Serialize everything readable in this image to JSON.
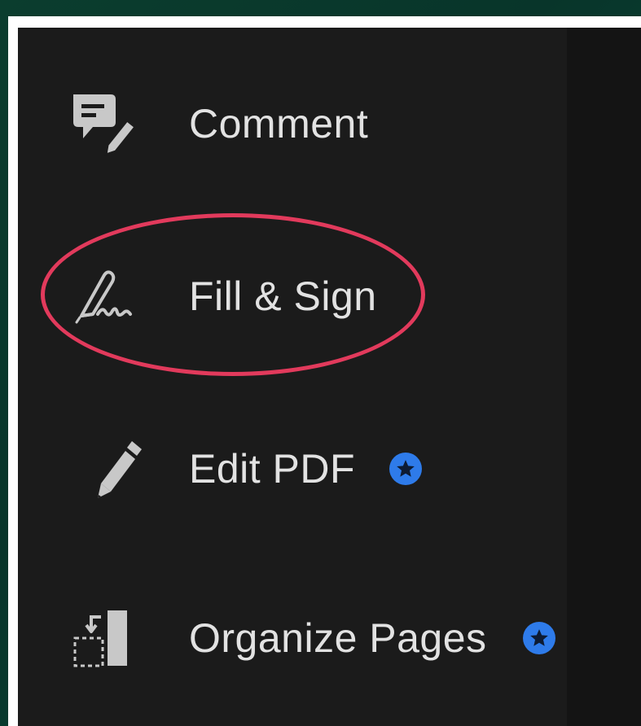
{
  "tools": {
    "comment": {
      "label": "Comment",
      "icon": "comment-icon"
    },
    "fill_sign": {
      "label": "Fill & Sign",
      "icon": "fill-sign-icon",
      "highlighted": true
    },
    "edit_pdf": {
      "label": "Edit PDF",
      "icon": "pencil-icon",
      "premium": true
    },
    "organize_pages": {
      "label": "Organize Pages",
      "icon": "organize-pages-icon",
      "premium": true
    }
  },
  "colors": {
    "panel_background": "#1b1b1b",
    "label_text": "#e2e2e2",
    "icon_gray": "#c8c8c8",
    "premium_badge": "#2e7bea",
    "highlight": "#e23a5c"
  }
}
